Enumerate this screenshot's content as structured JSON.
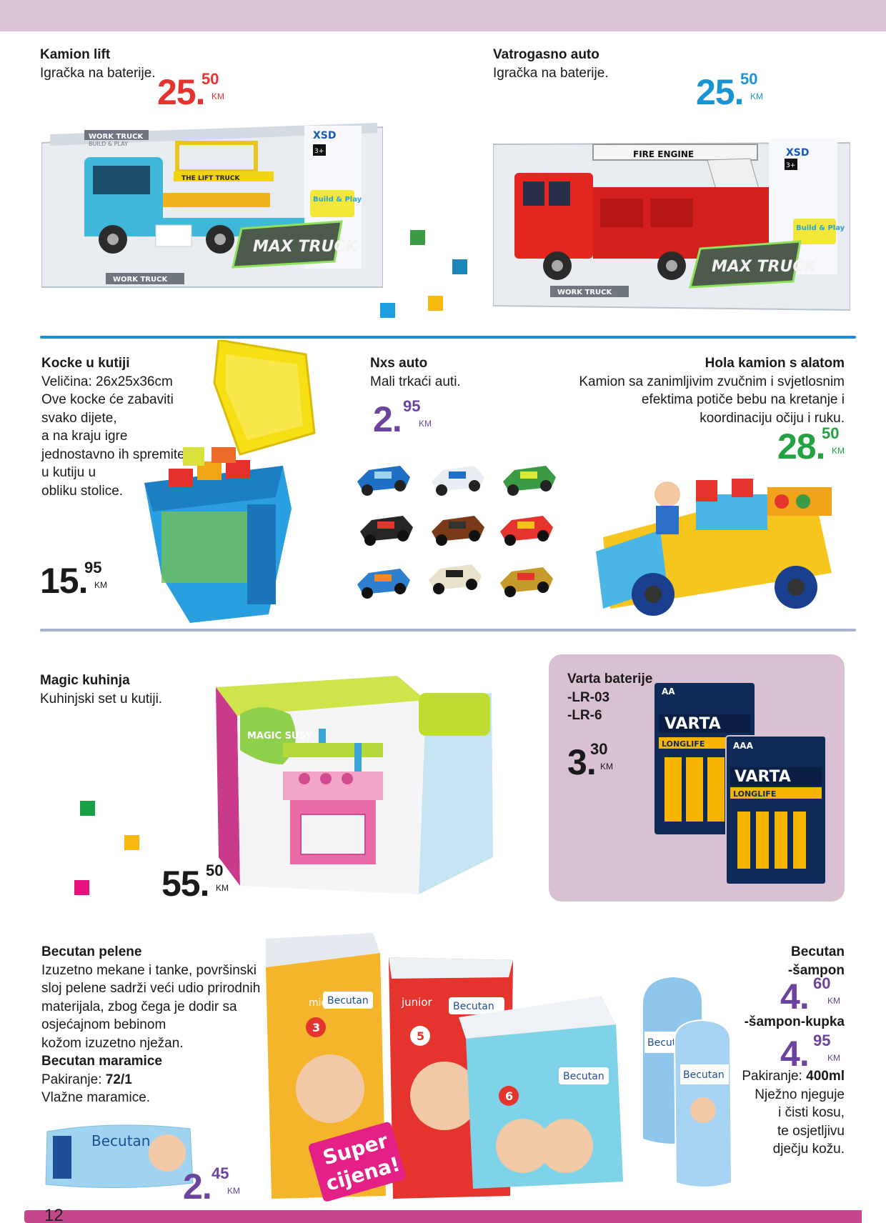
{
  "page": {
    "number": "12"
  },
  "products": {
    "kamion_lift": {
      "title": "Kamion lift",
      "desc": "Igračka na baterije.",
      "price_int": "25",
      "price_dec": "50",
      "currency": "KM"
    },
    "vatrogasno": {
      "title": "Vatrogasno auto",
      "desc": "Igračka na baterije.",
      "price_int": "25",
      "price_dec": "50",
      "currency": "KM"
    },
    "kocke": {
      "title": "Kocke u kutiji",
      "lines": [
        "Veličina: 26x25x36cm",
        "Ove kocke će zabaviti",
        "svako dijete,",
        "a na kraju igre",
        "jednostavno ih spremite",
        "u kutiju u",
        "obliku stolice."
      ],
      "price_int": "15",
      "price_dec": "95",
      "currency": "KM"
    },
    "nxs": {
      "title": "Nxs auto",
      "desc": "Mali trkaći auti.",
      "price_int": "2",
      "price_dec": "95",
      "currency": "KM"
    },
    "hola": {
      "title": "Hola kamion s alatom",
      "lines": [
        "Kamion sa zanimljivim zvučnim i svjetlosnim",
        "efektima potiče bebu na kretanje i",
        "koordinaciju očiju i ruku."
      ],
      "price_int": "28",
      "price_dec": "50",
      "currency": "KM"
    },
    "magic": {
      "title": "Magic kuhinja",
      "desc": "Kuhinjski set u kutiji.",
      "price_int": "55",
      "price_dec": "50",
      "currency": "KM"
    },
    "varta": {
      "title": "Varta baterije",
      "lines": [
        "-LR-03",
        "-LR-6"
      ],
      "price_int": "3",
      "price_dec": "30",
      "currency": "KM"
    },
    "becutan_pelene": {
      "title": "Becutan pelene",
      "lines": [
        "Izuzetno mekane i tanke, površinski",
        "sloj pelene sadrži veći udio prirodnih",
        "materijala, zbog čega je dodir sa",
        "osjećajnom bebinom",
        "kožom izuzetno nježan."
      ],
      "sub_title": "Becutan maramice",
      "pack_label": "Pakiranje: ",
      "pack_value": "72/1",
      "sub_desc": "Vlažne maramice.",
      "price_int": "2",
      "price_dec": "45",
      "currency": "KM"
    },
    "becutan_sampon": {
      "title1": "Becutan",
      "title2": "-šampon",
      "price1_int": "4",
      "price1_dec": "60",
      "title3": "-šampon-kupka",
      "price2_int": "4",
      "price2_dec": "95",
      "currency": "KM",
      "pack_label": "Pakiranje: ",
      "pack_value": "400ml",
      "lines": [
        "Nježno njeguje",
        "i čisti kosu,",
        "te osjetljivu",
        "dječju kožu."
      ]
    }
  },
  "package_text": {
    "work_truck": "WORK TRUCK",
    "build_play": "BUILD & PLAY",
    "lift_truck": "THE LIFT TRUCK",
    "fire_engine": "FIRE ENGINE",
    "max_truck": "MAX TRUCK",
    "xsd": "XSD",
    "age": "3+",
    "build_play_badge": "Build & Play",
    "magic_susy": "MAGIC SUSY",
    "varta": "VARTA",
    "longlife": "LONGLIFE",
    "aa": "AA",
    "aaa": "AAA",
    "becutan": "Becutan",
    "midi": "midi",
    "junior": "junior",
    "size3": "3",
    "size5": "5",
    "size6": "6",
    "super1": "Super",
    "super2": "cijena!"
  },
  "colors": {
    "top_band": "#dcc3d3",
    "bottom_band": "#c5478b",
    "price_red": "#e4342d",
    "price_blue": "#1993d2",
    "price_purple": "#6c44a0",
    "price_green": "#22a240",
    "panel": "#d9c0d2",
    "divider_blue": "#1e8ed3",
    "divider_grey": "#a7b3d1"
  }
}
